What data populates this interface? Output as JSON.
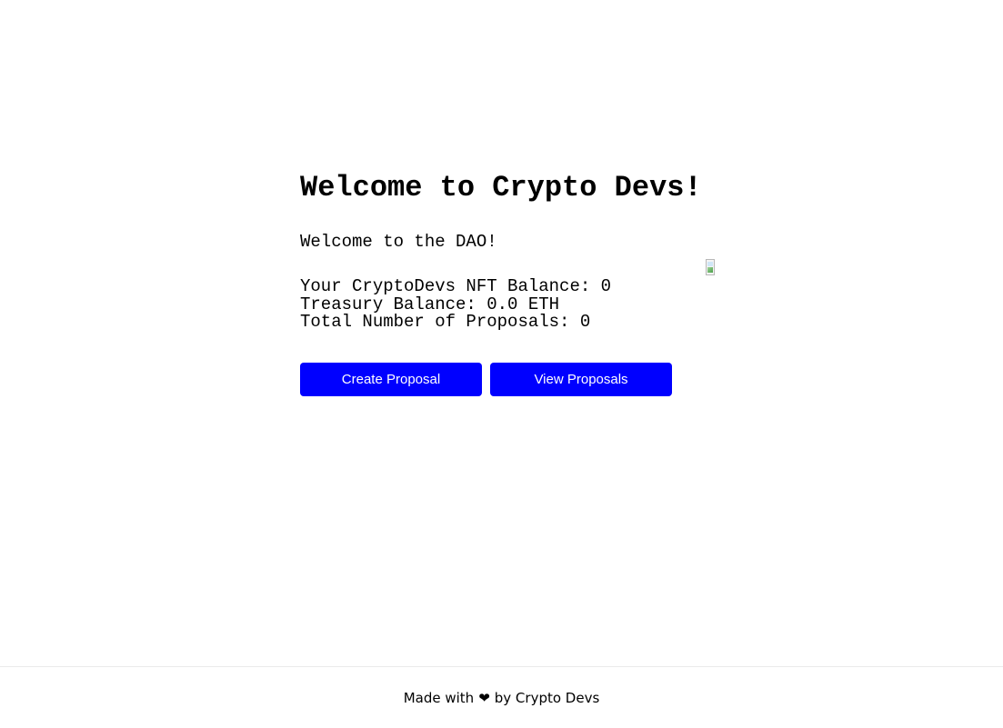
{
  "main": {
    "title": "Welcome to Crypto Devs!",
    "description": "Welcome to the DAO!",
    "stats": {
      "nft_balance": "Your CryptoDevs NFT Balance: 0",
      "treasury_balance": "Treasury Balance: 0.0 ETH",
      "total_proposals": "Total Number of Proposals: 0"
    },
    "buttons": {
      "create": "Create Proposal",
      "view": "View Proposals"
    }
  },
  "image": {
    "icon": "broken-image-icon"
  },
  "footer": {
    "prefix": "Made with",
    "heart": "❤",
    "suffix": "by Crypto Devs"
  },
  "colors": {
    "button_bg": "#0000ff",
    "button_text": "#ffffff",
    "footer_border": "#eaeaea"
  }
}
